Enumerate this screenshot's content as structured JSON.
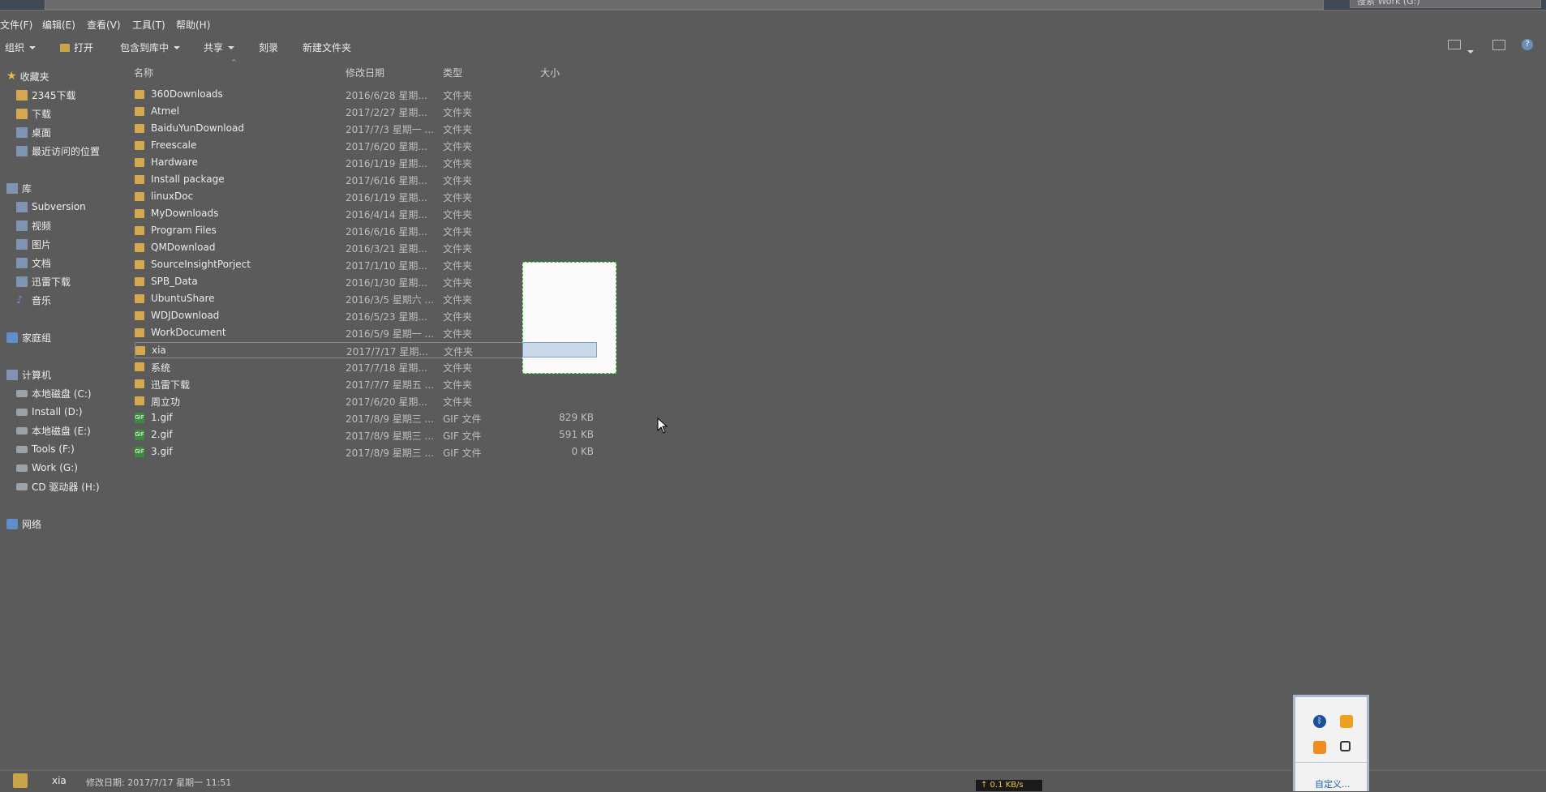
{
  "search": {
    "placeholder": "搜索 Work (G:)"
  },
  "menu": [
    "文件(F)",
    "编辑(E)",
    "查看(V)",
    "工具(T)",
    "帮助(H)"
  ],
  "toolbar": {
    "organize": "组织",
    "open": "打开",
    "include_library": "包含到库中",
    "share": "共享",
    "burn": "刻录",
    "new_folder": "新建文件夹"
  },
  "nav": {
    "favorites": "收藏夹",
    "fav_items": [
      "2345下载",
      "下载",
      "桌面",
      "最近访问的位置"
    ],
    "libraries": "库",
    "lib_items": [
      "Subversion",
      "视频",
      "图片",
      "文档",
      "迅雷下载",
      "音乐"
    ],
    "homegroup": "家庭组",
    "computer": "计算机",
    "drives": [
      "本地磁盘 (C:)",
      "Install (D:)",
      "本地磁盘 (E:)",
      "Tools (F:)",
      "Work (G:)",
      "CD 驱动器 (H:)"
    ],
    "network": "网络"
  },
  "columns": {
    "name": "名称",
    "date": "修改日期",
    "type": "类型",
    "size": "大小"
  },
  "files": [
    {
      "name": "360Downloads",
      "date": "2016/6/28 星期...",
      "type": "文件夹",
      "size": "",
      "kind": "folder"
    },
    {
      "name": "Atmel",
      "date": "2017/2/27 星期...",
      "type": "文件夹",
      "size": "",
      "kind": "folder"
    },
    {
      "name": "BaiduYunDownload",
      "date": "2017/7/3 星期一 ...",
      "type": "文件夹",
      "size": "",
      "kind": "folder"
    },
    {
      "name": "Freescale",
      "date": "2017/6/20 星期...",
      "type": "文件夹",
      "size": "",
      "kind": "folder"
    },
    {
      "name": "Hardware",
      "date": "2016/1/19 星期...",
      "type": "文件夹",
      "size": "",
      "kind": "folder"
    },
    {
      "name": "Install package",
      "date": "2017/6/16 星期...",
      "type": "文件夹",
      "size": "",
      "kind": "folder"
    },
    {
      "name": "linuxDoc",
      "date": "2016/1/19 星期...",
      "type": "文件夹",
      "size": "",
      "kind": "folder"
    },
    {
      "name": "MyDownloads",
      "date": "2016/4/14 星期...",
      "type": "文件夹",
      "size": "",
      "kind": "folder"
    },
    {
      "name": "Program Files",
      "date": "2016/6/16 星期...",
      "type": "文件夹",
      "size": "",
      "kind": "folder"
    },
    {
      "name": "QMDownload",
      "date": "2016/3/21 星期...",
      "type": "文件夹",
      "size": "",
      "kind": "folder"
    },
    {
      "name": "SourceInsightPorject",
      "date": "2017/1/10 星期...",
      "type": "文件夹",
      "size": "",
      "kind": "folder"
    },
    {
      "name": "SPB_Data",
      "date": "2016/1/30 星期...",
      "type": "文件夹",
      "size": "",
      "kind": "folder"
    },
    {
      "name": "UbuntuShare",
      "date": "2016/3/5 星期六 ...",
      "type": "文件夹",
      "size": "",
      "kind": "folder"
    },
    {
      "name": "WDJDownload",
      "date": "2016/5/23 星期...",
      "type": "文件夹",
      "size": "",
      "kind": "folder"
    },
    {
      "name": "WorkDocument",
      "date": "2016/5/9 星期一 ...",
      "type": "文件夹",
      "size": "",
      "kind": "folder"
    },
    {
      "name": "xia",
      "date": "2017/7/17 星期...",
      "type": "文件夹",
      "size": "",
      "kind": "folder"
    },
    {
      "name": "系统",
      "date": "2017/7/18 星期...",
      "type": "文件夹",
      "size": "",
      "kind": "folder"
    },
    {
      "name": "迅雷下载",
      "date": "2017/7/7 星期五 ...",
      "type": "文件夹",
      "size": "",
      "kind": "folder"
    },
    {
      "name": "周立功",
      "date": "2017/6/20 星期...",
      "type": "文件夹",
      "size": "",
      "kind": "folder"
    },
    {
      "name": "1.gif",
      "date": "2017/8/9 星期三 ...",
      "type": "GIF 文件",
      "size": "829 KB",
      "kind": "gif"
    },
    {
      "name": "2.gif",
      "date": "2017/8/9 星期三 ...",
      "type": "GIF 文件",
      "size": "591 KB",
      "kind": "gif"
    },
    {
      "name": "3.gif",
      "date": "2017/8/9 星期三 ...",
      "type": "GIF 文件",
      "size": "0 KB",
      "kind": "gif"
    }
  ],
  "status": {
    "name": "xia",
    "modified": "修改日期: 2017/7/17 星期一 11:51"
  },
  "tray": {
    "customize": "自定义..."
  },
  "netspeed": "↑ 0.1 KB/s"
}
